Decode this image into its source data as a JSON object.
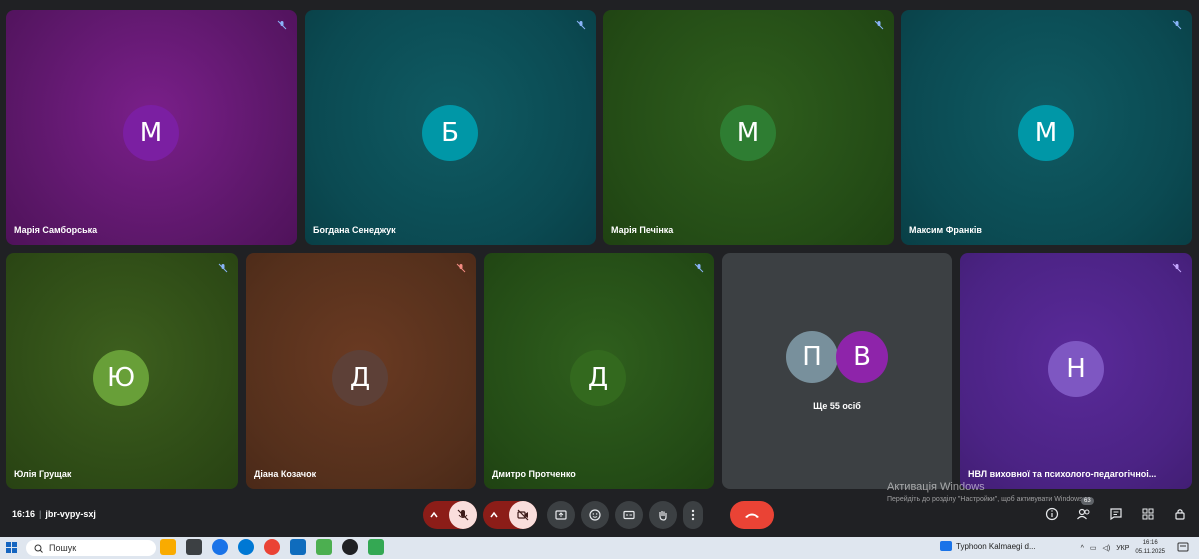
{
  "tiles": [
    {
      "name": "Марія Самборська",
      "initial": "М",
      "avatar_color": "#7b1fa2"
    },
    {
      "name": "Богдана Сенеджук",
      "initial": "Б",
      "avatar_color": "#0097a7"
    },
    {
      "name": "Марія Печінка",
      "initial": "М",
      "avatar_color": "#2e7d32"
    },
    {
      "name": "Максим Франків",
      "initial": "М",
      "avatar_color": "#0097a7"
    },
    {
      "name": "Юлія Грущак",
      "initial": "Ю",
      "avatar_color": "#689f38"
    },
    {
      "name": "Діана Козачок",
      "initial": "Д",
      "avatar_color": "#5d4037"
    },
    {
      "name": "Дмитро Протченко",
      "initial": "Д",
      "avatar_color": "#33691e"
    },
    {
      "name": "НВЛ виховної та психолого-педагогічноі...",
      "initial": "Н",
      "avatar_color": "#7e57c2"
    }
  ],
  "more": {
    "initial_1": "П",
    "initial_2": "В",
    "label": "Ще 55 осіб",
    "color_1": "#78909c",
    "color_2": "#8e24aa"
  },
  "meeting": {
    "time": "16:16",
    "code": "jbr-vypy-sxj"
  },
  "watermark": {
    "title": "Активація Windows",
    "subtitle": "Перейдіть до розділу \"Настройки\", щоб активувати Windows."
  },
  "participants_badge": "63",
  "taskbar": {
    "search_placeholder": "Пошук",
    "task_label": "Typhoon Kalmaegi d...",
    "lang": "УКР",
    "clock_time": "16:16",
    "clock_date": "05.11.2025"
  },
  "colors": {
    "end_call": "#ea4335",
    "muted_bg": "#f9dedc",
    "muted_pill": "#8c1d18"
  }
}
